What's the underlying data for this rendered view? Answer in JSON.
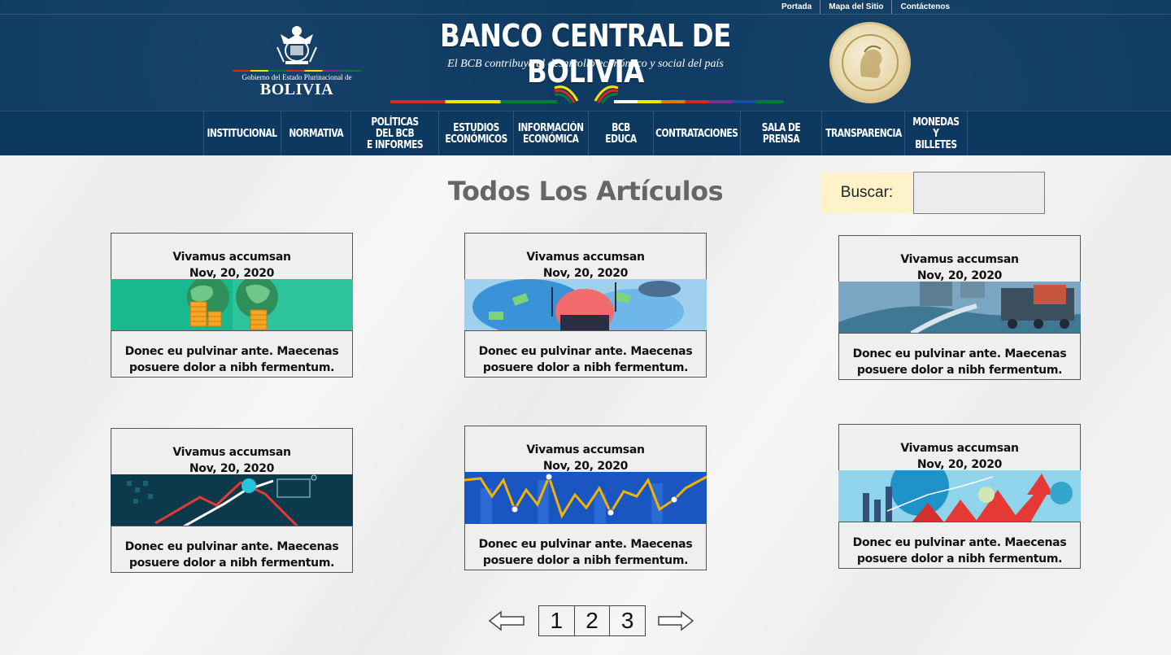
{
  "top_links": [
    "Portada",
    "Mapa del Sitio",
    "Contáctenos"
  ],
  "gov_logo": {
    "line1": "Gobierno del Estado Plurinacional de",
    "line2": "BOLIVIA"
  },
  "bank": {
    "title": "BANCO CENTRAL DE BOLIVIA",
    "tagline": "El BCB contribuye al desarrollo económico y social del país"
  },
  "nav": [
    {
      "id": "institucional",
      "label": "INSTITUCIONAL"
    },
    {
      "id": "normativa",
      "label": "NORMATIVA"
    },
    {
      "id": "politicas",
      "label": "POLÍTICAS DEL BCB\nE INFORMES"
    },
    {
      "id": "estudios",
      "label": "ESTUDIOS\nECONÓMICOS"
    },
    {
      "id": "informacion",
      "label": "INFORMACIÓN\nECONÓMICA"
    },
    {
      "id": "bcb-educa",
      "label": "BCB EDUCA"
    },
    {
      "id": "contrataciones",
      "label": "CONTRATACIONES"
    },
    {
      "id": "sala-prensa",
      "label": "SALA DE PRENSA"
    },
    {
      "id": "transparencia",
      "label": "TRANSPARENCIA"
    },
    {
      "id": "monedas",
      "label": "MONEDAS Y\nBILLETES"
    }
  ],
  "main": {
    "title": "Todos Los Artículos",
    "search_label": "Buscar:",
    "search_value": ""
  },
  "articles": [
    {
      "title": "Vivamus accumsan",
      "date": "Nov, 20, 2020",
      "excerpt_1": "Donec eu pulvinar ante. Maecenas",
      "excerpt_2": "posuere dolor a nibh fermentum."
    },
    {
      "title": "Vivamus accumsan",
      "date": "Nov, 20, 2020",
      "excerpt_1": "Donec eu pulvinar ante. Maecenas",
      "excerpt_2": "posuere dolor a nibh fermentum."
    },
    {
      "title": "Vivamus accumsan",
      "date": "Nov, 20, 2020",
      "excerpt_1": "Donec eu pulvinar ante. Maecenas",
      "excerpt_2": "posuere dolor a nibh fermentum."
    },
    {
      "title": "Vivamus accumsan",
      "date": "Nov, 20, 2020",
      "excerpt_1": "Donec eu pulvinar ante. Maecenas",
      "excerpt_2": "posuere dolor a nibh fermentum."
    },
    {
      "title": "Vivamus accumsan",
      "date": "Nov, 20, 2020",
      "excerpt_1": "Donec eu pulvinar ante. Maecenas",
      "excerpt_2": "posuere dolor a nibh fermentum."
    },
    {
      "title": "Vivamus accumsan",
      "date": "Nov, 20, 2020",
      "excerpt_1": "Donec eu pulvinar ante. Maecenas",
      "excerpt_2": "posuere dolor a nibh fermentum."
    }
  ],
  "pagination": {
    "pages": [
      "1",
      "2",
      "3"
    ],
    "prev_icon": "left-arrow-icon",
    "next_icon": "right-arrow-icon"
  },
  "colors": {
    "header_bg": "#0e3a62",
    "card_bg": "#efefef",
    "search_label_bg": "#fdf2c8",
    "title_gray": "#666666"
  }
}
